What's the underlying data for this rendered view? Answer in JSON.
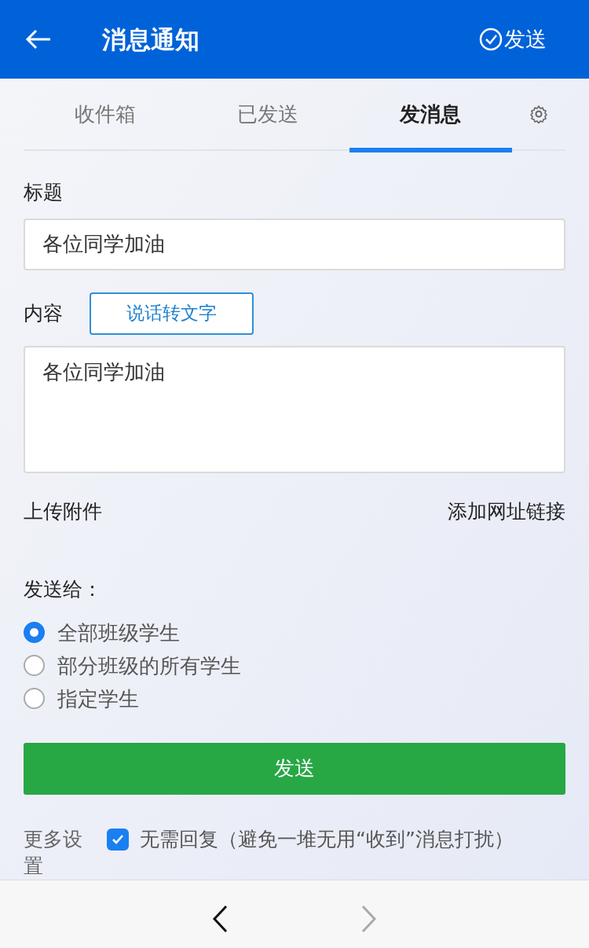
{
  "header": {
    "title": "消息通知",
    "action": "发送"
  },
  "tabs": [
    {
      "label": "收件箱",
      "selected": false
    },
    {
      "label": "已发送",
      "selected": false
    },
    {
      "label": "发消息",
      "selected": true
    }
  ],
  "form": {
    "title_label": "标题",
    "title_value": "各位同学加油",
    "content_label": "内容",
    "voice_button": "说话转文字",
    "content_value": "各位同学加油",
    "upload_link": "上传附件",
    "url_link": "添加网址链接",
    "recipients_label": "发送给：",
    "recipients": [
      {
        "label": "全部班级学生",
        "selected": true
      },
      {
        "label": "部分班级的所有学生",
        "selected": false
      },
      {
        "label": "指定学生",
        "selected": false
      }
    ],
    "send_button": "发送",
    "more_settings_label": "更多设置",
    "no_reply": {
      "label": "无需回复（避免一堆无用“收到”消息打扰）",
      "checked": true
    }
  },
  "nav": {
    "back_enabled": true,
    "forward_enabled": false
  }
}
